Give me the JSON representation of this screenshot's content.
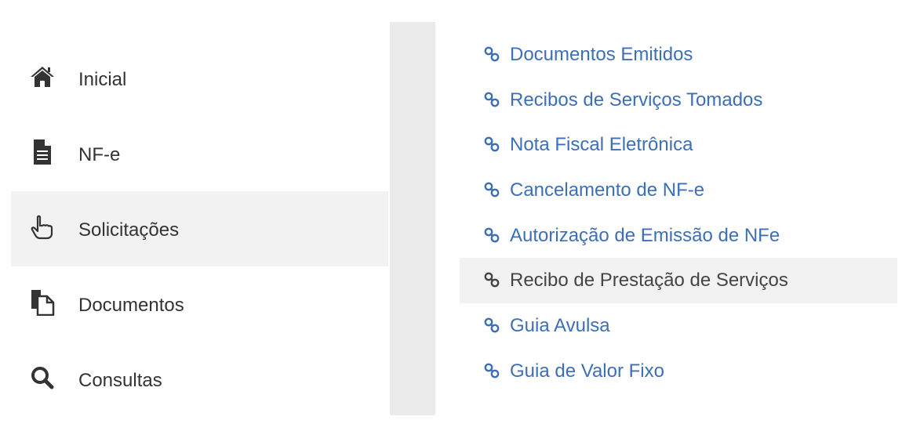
{
  "sidebar": {
    "items": [
      {
        "label": "Inicial",
        "icon": "home-icon",
        "active": false
      },
      {
        "label": "NF-e",
        "icon": "file-text-icon",
        "active": false
      },
      {
        "label": "Solicitações",
        "icon": "hand-pointer-icon",
        "active": true
      },
      {
        "label": "Documentos",
        "icon": "copy-documents-icon",
        "active": false
      },
      {
        "label": "Consultas",
        "icon": "search-icon",
        "active": false
      }
    ]
  },
  "submenu": {
    "items": [
      {
        "label": "Documentos Emitidos",
        "icon": "link-icon",
        "active": false
      },
      {
        "label": "Recibos de Serviços Tomados",
        "icon": "link-icon",
        "active": false
      },
      {
        "label": "Nota Fiscal Eletrônica",
        "icon": "link-icon",
        "active": false
      },
      {
        "label": "Cancelamento de NF-e",
        "icon": "link-icon",
        "active": false
      },
      {
        "label": "Autorização de Emissão de NFe",
        "icon": "link-icon",
        "active": false
      },
      {
        "label": "Recibo de Prestação de Serviços",
        "icon": "link-icon",
        "active": true
      },
      {
        "label": "Guia Avulsa",
        "icon": "link-icon",
        "active": false
      },
      {
        "label": "Guia de Valor Fixo",
        "icon": "link-icon",
        "active": false
      }
    ]
  },
  "colors": {
    "link": "#3d6fb6",
    "active_bg": "#f2f2f2",
    "divider": "#ebebeb",
    "text": "#333333"
  }
}
